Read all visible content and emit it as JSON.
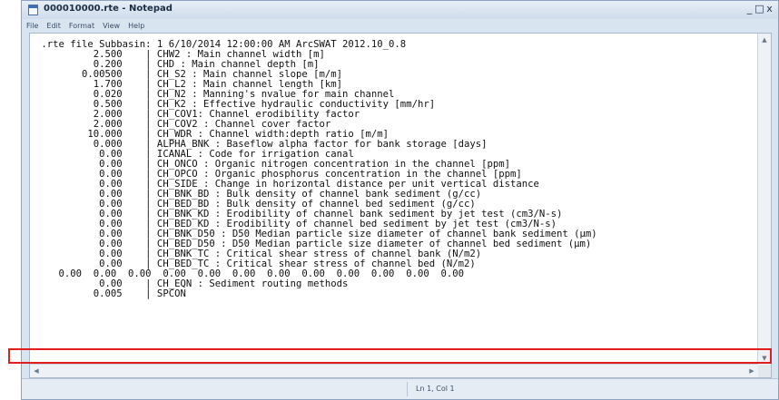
{
  "window": {
    "title": "000010000.rte - Notepad"
  },
  "window_buttons": [
    "_",
    "□",
    "x"
  ],
  "menu": [
    "File",
    "Edit",
    "Format",
    "View",
    "Help"
  ],
  "lines": [
    " .rte file Subbasin: 1 6/10/2014 12:00:00 AM ArcSWAT 2012.10_0.8",
    "          2.500    | CHW2 : Main channel width [m]",
    "          0.200    | CHD : Main channel depth [m]",
    "        0.00500    | CH_S2 : Main channel slope [m/m]",
    "          1.700    | CH_L2 : Main channel length [km]",
    "          0.020    | CH_N2 : Manning's nvalue for main channel",
    "          0.500    | CH_K2 : Effective hydraulic conductivity [mm/hr]",
    "          2.000    | CH_COV1: Channel erodibility factor",
    "          2.000    | CH_COV2 : Channel cover factor",
    "         10.000    | CH_WDR : Channel width:depth ratio [m/m]",
    "          0.000    | ALPHA_BNK : Baseflow alpha factor for bank storage [days]",
    "           0.00    | ICANAL : Code for irrigation canal",
    "           0.00    | CH_ONCO : Organic nitrogen concentration in the channel [ppm]",
    "           0.00    | CH_OPCO : Organic phosphorus concentration in the channel [ppm]",
    "           0.00    | CH_SIDE : Change in horizontal distance per unit vertical distance",
    "           0.00    | CH_BNK_BD : Bulk density of channel bank sediment (g/cc)",
    "           0.00    | CH_BED_BD : Bulk density of channel bed sediment (g/cc)",
    "           0.00    | CH_BNK_KD : Erodibility of channel bank sediment by jet test (cm3/N-s)",
    "           0.00    | CH_BED_KD : Erodibility of channel bed sediment by jet test (cm3/N-s)",
    "           0.00    | CH_BNK_D50 : D50 Median particle size diameter of channel bank sediment (μm)",
    "           0.00    | CH_BED_D50 : D50 Median particle size diameter of channel bed sediment (μm)",
    "           0.00    | CH_BNK_TC : Critical shear stress of channel bank (N/m2)",
    "           0.00    | CH_BED_TC : Critical shear stress of channel bed (N/m2)",
    "    0.00  0.00  0.00  0.00  0.00  0.00  0.00  0.00  0.00  0.00  0.00  0.00",
    "           0.00    | CH_EQN : Sediment routing methods",
    "          0.005    | SPCON"
  ],
  "status": {
    "position": "Ln 1, Col 1"
  }
}
